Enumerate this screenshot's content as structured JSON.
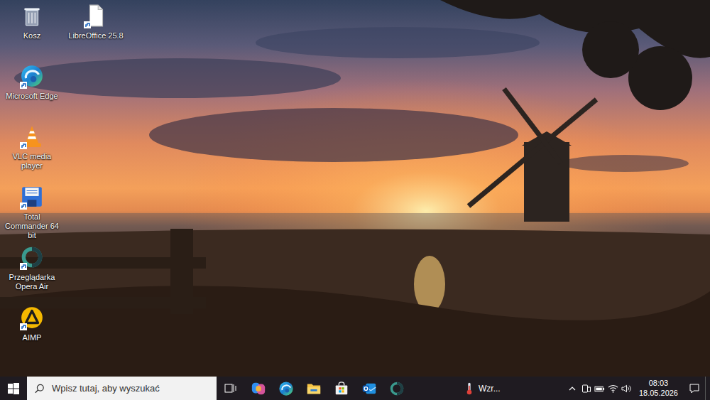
{
  "desktop": {
    "icons": [
      {
        "label": "Kosz",
        "kind": "recycle-bin",
        "shortcut": false
      },
      {
        "label": "Microsoft Edge",
        "kind": "edge",
        "shortcut": true
      },
      {
        "label": "VLC media player",
        "kind": "vlc",
        "shortcut": true
      },
      {
        "label": "Total Commander 64 bit",
        "kind": "total-commander",
        "shortcut": true
      },
      {
        "label": "Przeglądarka Opera Air",
        "kind": "opera-air",
        "shortcut": true
      },
      {
        "label": "AIMP",
        "kind": "aimp",
        "shortcut": true
      },
      {
        "label": "LibreOffice 25.8",
        "kind": "libreoffice",
        "shortcut": true
      }
    ]
  },
  "taskbar": {
    "search": {
      "placeholder": "Wpisz tutaj, aby wyszukać"
    },
    "pinned": [
      {
        "kind": "copilot"
      },
      {
        "kind": "edge"
      },
      {
        "kind": "explorer"
      },
      {
        "kind": "store"
      },
      {
        "kind": "outlook"
      },
      {
        "kind": "opera-air"
      }
    ],
    "weather": {
      "label": "Wzr..."
    },
    "clock": {
      "time": "08:03",
      "date": "18.05.2026"
    }
  }
}
